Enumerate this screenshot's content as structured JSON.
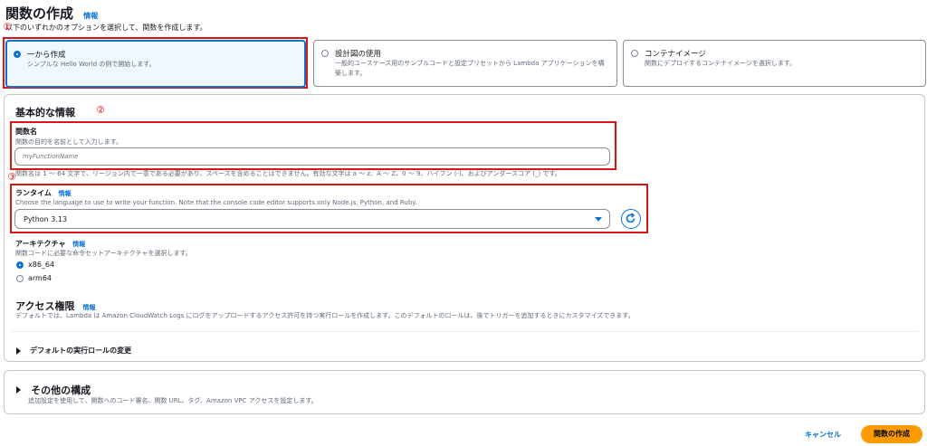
{
  "header": {
    "title": "関数の作成",
    "info_link": "情報",
    "subtitle": "以下のいずれかのオプションを選択して、関数を作成します。"
  },
  "options": [
    {
      "title": "一から作成",
      "desc": "シンプルな Hello World の例で開始します。",
      "selected": true
    },
    {
      "title": "設計図の使用",
      "desc": "一般的ユースケース用のサンプルコードと設定プリセットから Lambda アプリケーションを構築します。",
      "selected": false
    },
    {
      "title": "コンテナイメージ",
      "desc": "関数にデプロイするコンテナイメージを選択します。",
      "selected": false
    }
  ],
  "basic": {
    "heading": "基本的な情報",
    "function_name": {
      "label": "関数名",
      "desc": "関数の目的を名前として入力します。",
      "placeholder": "myFunctionName",
      "constraint": "関数名は 1 ～ 64 文字で、リージョン内で一意である必要があり、スペースを含めることはできません。有効な文字は a ～ z、A ～ Z、0 ～ 9、ハイフン (-)、およびアンダースコア (_) です。"
    },
    "runtime": {
      "label": "ランタイム",
      "info_link": "情報",
      "desc": "Choose the language to use to write your function. Note that the console code editor supports only Node.js, Python, and Ruby.",
      "value": "Python 3.13",
      "refresh_icon": "refresh-icon"
    },
    "architecture": {
      "label": "アーキテクチャ",
      "info_link": "情報",
      "desc": "関数コードに必要な命令セットアーキテクチャを選択します。",
      "options": [
        {
          "label": "x86_64",
          "selected": true
        },
        {
          "label": "arm64",
          "selected": false
        }
      ]
    },
    "permissions": {
      "label": "アクセス権限",
      "info_link": "情報",
      "desc": "デフォルトでは、Lambda は Amazon CloudWatch Logs にログをアップロードするアクセス許可を持つ実行ロールを作成します。このデフォルトのロールは、後でトリガーを追加するときにカスタマイズできます。"
    },
    "default_role_toggle": "デフォルトの実行ロールの変更"
  },
  "other": {
    "heading": "その他の構成",
    "desc": "追加設定を使用して、関数へのコード署名、関数 URL、タグ、Amazon VPC アクセスを設定します。"
  },
  "footer": {
    "cancel": "キャンセル",
    "create": "関数の作成"
  },
  "annotations": {
    "one": "①",
    "two": "②",
    "three": "③"
  },
  "colors": {
    "accent": "#0972d3",
    "primary_button": "#ff9900",
    "annotation": "#d91515"
  }
}
